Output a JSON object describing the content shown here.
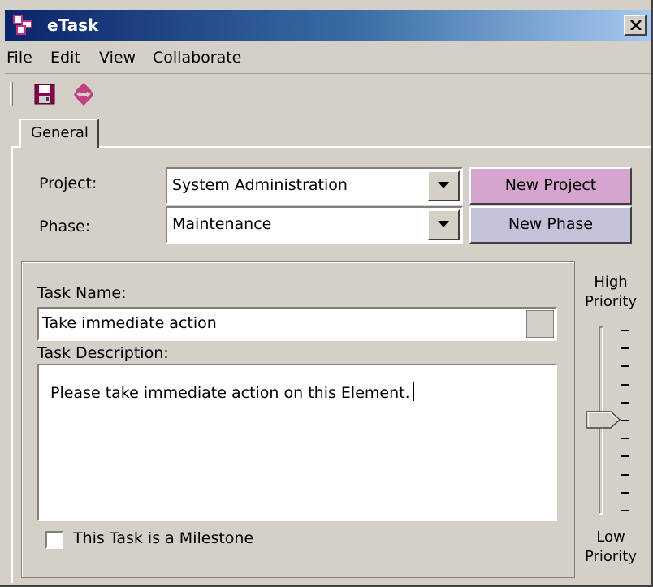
{
  "window": {
    "title": "eTask",
    "accent": "#0a246a"
  },
  "menu": [
    "File",
    "Edit",
    "View",
    "Collaborate"
  ],
  "toolbar": {
    "icons": [
      "save-icon",
      "refresh-icon"
    ]
  },
  "tabs": [
    {
      "label": "General",
      "selected": true
    }
  ],
  "form": {
    "project_label": "Project:",
    "project_value": "System Administration",
    "new_project_label": "New Project",
    "new_project_color": "#d6a5cf",
    "phase_label": "Phase:",
    "phase_value": "Maintenance",
    "new_phase_label": "New Phase",
    "new_phase_color": "#c3c2d8"
  },
  "task": {
    "name_label": "Task Name:",
    "name_value": "Take immediate action",
    "description_label": "Task Description:",
    "description_value": "Please take immediate action on this Element.",
    "milestone_label": "This Task is a Milestone",
    "milestone_checked": false
  },
  "priority": {
    "high_label_line1": "High",
    "high_label_line2": "Priority",
    "low_label_line1": "Low",
    "low_label_line2": "Priority",
    "level": 0.5
  }
}
